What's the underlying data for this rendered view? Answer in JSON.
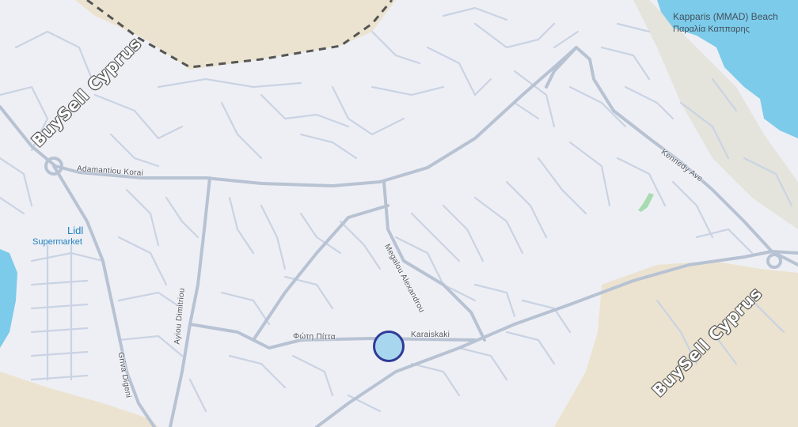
{
  "map": {
    "poi": {
      "lidl": {
        "title": "Lidl",
        "subtitle": "Supermarket"
      },
      "beach": {
        "title": "Kapparis (MMAD) Beach",
        "subtitle": "Παραλία Καππαρης"
      }
    },
    "streets": {
      "adamantiou_korai": "Adamantiou Korai",
      "megalou_alexandrou": "Megalou Alexandrou",
      "karaiskaki": "Karaiskaki",
      "foti_pitta": "Φώτη Πίττα",
      "ayiou_dimitriou": "Ayiou Dimitriou",
      "griva_digeni": "Griva Digeni",
      "kennedy_ave": "Kennedy Ave"
    },
    "watermarks": [
      "BuySell Cyprus",
      "BuySell Cyprus"
    ],
    "colors": {
      "land": "#eeeff4",
      "water": "#7ccbea",
      "sand": "#ebe3cf",
      "road": "#c7d1e0",
      "major_road": "#b3bfcf",
      "marker_fill": "#a8d6ee",
      "marker_stroke": "#2f3a98"
    }
  }
}
